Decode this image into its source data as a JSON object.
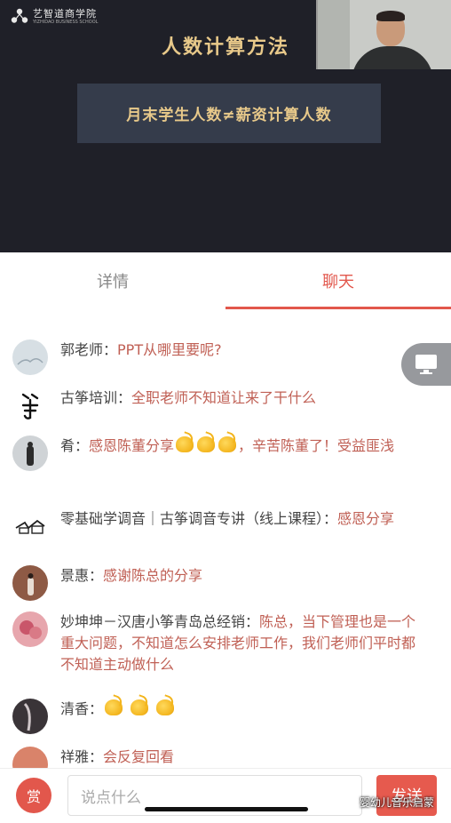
{
  "video": {
    "logo_cn": "艺智道商学院",
    "logo_en": "YIZHIDAO BUSINESS SCHOOL",
    "slide_title": "人数计算方法",
    "slide_text": "月末学生人数≠薪资计算人数"
  },
  "tabs": [
    {
      "label": "详情",
      "active": false
    },
    {
      "label": "聊天",
      "active": true
    }
  ],
  "messages": [
    {
      "name": "郭老师：",
      "text": "PPT从哪里要呢?",
      "avatar": "landscape-avatar"
    },
    {
      "name": "古筝培训：",
      "text": "全职老师不知道让来了干什么",
      "avatar": "calligraphy-avatar"
    },
    {
      "name": "肴：",
      "text": "感恩陈董分享",
      "emoji_count": 3,
      "text_after": "，辛苦陈董了！受益匪浅",
      "avatar": "person-avatar"
    },
    {
      "name": "零基础学调音｜古筝调音专讲（线上课程）：",
      "text": "感恩分享",
      "avatar": "sketch-avatar"
    },
    {
      "name": "景惠：",
      "text": "感谢陈总的分享",
      "avatar": "brick-avatar"
    },
    {
      "name": "妙坤坤－汉唐小筝青岛总经销：",
      "text": "陈总，当下管理也是一个重大问题，不知道怎么安排老师工作，我们老师们平时都不知道主动做什么",
      "avatar": "pink-avatar"
    },
    {
      "name": "清香：",
      "text": "",
      "emoji_count": 3,
      "avatar": "dark-avatar"
    },
    {
      "name": "祥雅：",
      "text": "会反复回看",
      "avatar": "warm-avatar"
    }
  ],
  "input": {
    "placeholder": "说点什么"
  },
  "reward_label": "赏",
  "send_label": "发送",
  "watermark": "婴幼儿音乐启蒙",
  "colors": {
    "accent": "#e2574c",
    "slide_text": "#e8c98a",
    "video_bg": "#1f2028"
  }
}
